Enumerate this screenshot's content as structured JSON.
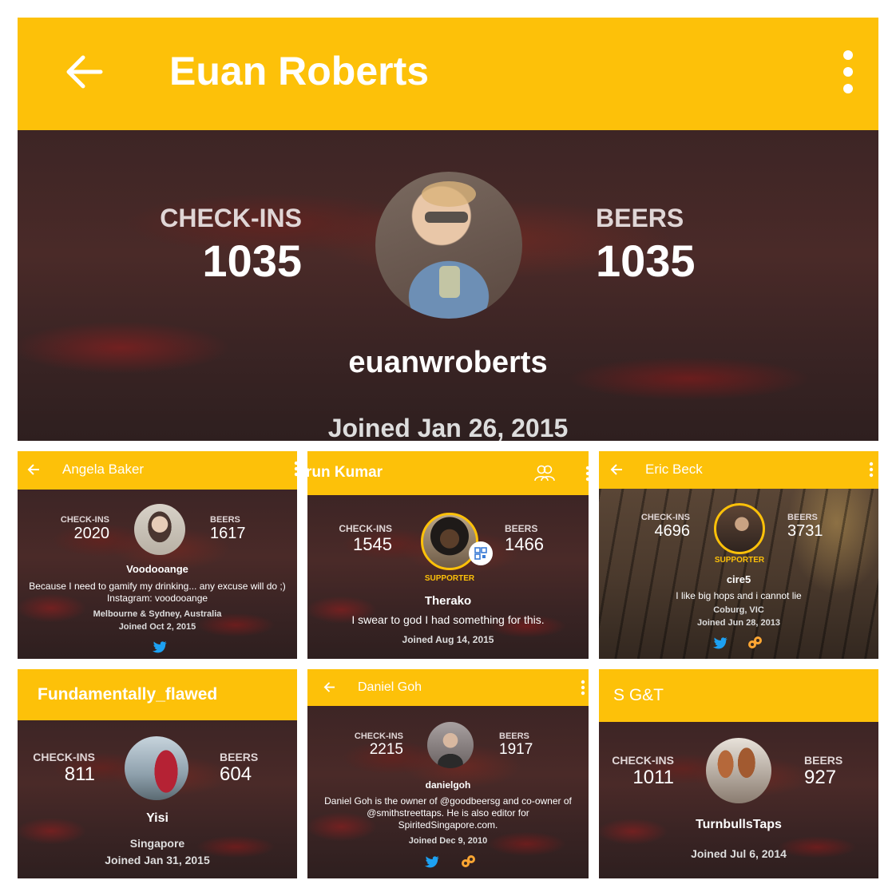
{
  "main": {
    "title": "Euan Roberts",
    "checkins_label": "CHECK-INS",
    "checkins": "1035",
    "beers_label": "BEERS",
    "beers": "1035",
    "username": "euanwroberts",
    "joined": "Joined Jan 26, 2015"
  },
  "angela": {
    "title": "Angela Baker",
    "checkins_label": "CHECK-INS",
    "checkins": "2020",
    "beers_label": "BEERS",
    "beers": "1617",
    "username": "Voodooange",
    "bio1": "Because I need to gamify my drinking... any excuse will do ;)",
    "bio2": "Instagram: voodooange",
    "location": "Melbourne & Sydney, Australia",
    "joined": "Joined Oct 2, 2015"
  },
  "arun": {
    "title": "run Kumar",
    "checkins_label": "CHECK-INS",
    "checkins": "1545",
    "beers_label": "BEERS",
    "beers": "1466",
    "badge": "SUPPORTER",
    "username": "Therako",
    "bio": "I swear to god I had something for this.",
    "joined": "Joined Aug 14, 2015"
  },
  "eric": {
    "title": "Eric Beck",
    "checkins_label": "CHECK-INS",
    "checkins": "4696",
    "beers_label": "BEERS",
    "beers": "3731",
    "badge": "SUPPORTER",
    "username": "cire5",
    "bio": "I like big hops and i cannot lie",
    "location": "Coburg, VIC",
    "joined": "Joined Jun 28, 2013"
  },
  "fundamentally": {
    "title": "Fundamentally_flawed",
    "checkins_label": "CHECK-INS",
    "checkins": "811",
    "beers_label": "BEERS",
    "beers": "604",
    "username": "Yisi",
    "location": "Singapore",
    "joined": "Joined Jan 31, 2015"
  },
  "daniel": {
    "title": "Daniel Goh",
    "checkins_label": "CHECK-INS",
    "checkins": "2215",
    "beers_label": "BEERS",
    "beers": "1917",
    "username": "danielgoh",
    "bio1": "Daniel Goh is the owner of @goodbeersg and co-owner of",
    "bio2": "@smithstreettaps. He is also editor for",
    "bio3": "SpiritedSingapore.com.",
    "joined": "Joined Dec 9, 2010"
  },
  "sgt": {
    "title": "S G&T",
    "checkins_label": "CHECK-INS",
    "checkins": "1011",
    "beers_label": "BEERS",
    "beers": "927",
    "username": "TurnbullsTaps",
    "joined": "Joined Jul 6, 2014"
  },
  "colors": {
    "accent": "#fdc109",
    "twitter": "#1da1f2"
  }
}
